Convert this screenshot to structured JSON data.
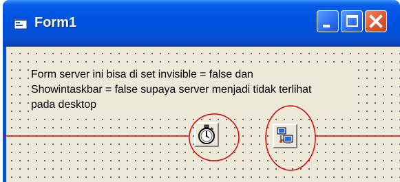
{
  "window": {
    "title": "Form1",
    "icon": "form-icon",
    "controls": {
      "minimize": "minimize-icon",
      "maximize": "maximize-icon",
      "close": "close-icon"
    }
  },
  "form": {
    "label_lines": [
      "Form server ini bisa di set invisible = false dan",
      "Showintaskbar = false supaya server menjadi tidak terlihat",
      "pada desktop"
    ],
    "components": [
      {
        "name": "timer",
        "icon": "stopwatch-icon"
      },
      {
        "name": "winsock",
        "icon": "network-computers-icon"
      }
    ]
  },
  "annotation": {
    "color": "#e00000"
  },
  "colors": {
    "titlebar": "#0054e3",
    "client": "#ece9d8",
    "close_button": "#e05a2e"
  }
}
